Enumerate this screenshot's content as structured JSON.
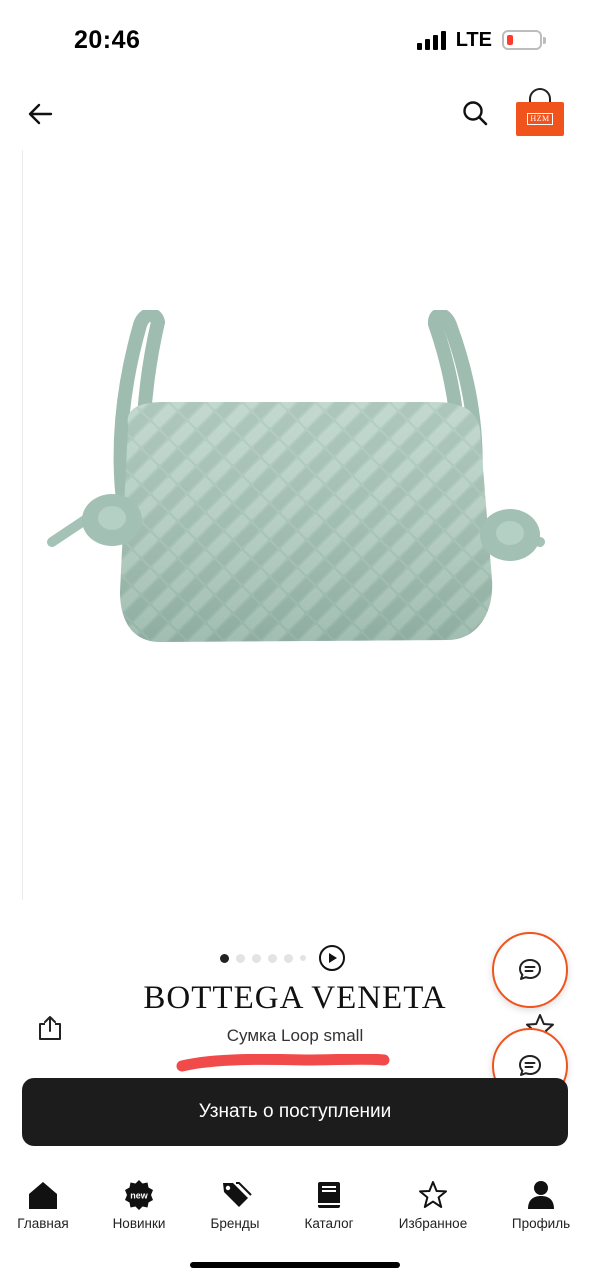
{
  "status_bar": {
    "time": "20:46",
    "network": "LTE",
    "battery_level": 0.2,
    "battery_color": "#ff3b30"
  },
  "header": {
    "back_icon": "arrow-left-icon",
    "search_icon": "search-icon",
    "logo_text": "HZM",
    "logo_color": "#f0531c"
  },
  "gallery": {
    "slide_count": 6,
    "active_slide": 1,
    "has_video": true
  },
  "product": {
    "brand": "BOTTEGA VENETA",
    "name": "Сумка Loop small",
    "price": "",
    "image_color": "#a7c4b8"
  },
  "actions": {
    "share_icon": "share-icon",
    "favorite_icon": "star-icon",
    "chat_icon": "chat-icon",
    "cta_label": "Узнать о поступлении"
  },
  "tabbar": {
    "items": [
      {
        "label": "Главная",
        "icon": "home-icon"
      },
      {
        "label": "Новинки",
        "icon": "new-badge-icon",
        "badge": "new"
      },
      {
        "label": "Бренды",
        "icon": "tags-icon"
      },
      {
        "label": "Каталог",
        "icon": "book-icon"
      },
      {
        "label": "Избранное",
        "icon": "star-outline-icon"
      },
      {
        "label": "Профиль",
        "icon": "user-icon"
      }
    ]
  },
  "colors": {
    "accent": "#f0531c",
    "cta_background": "#1c1c1c",
    "scribble": "#f14a4a"
  }
}
